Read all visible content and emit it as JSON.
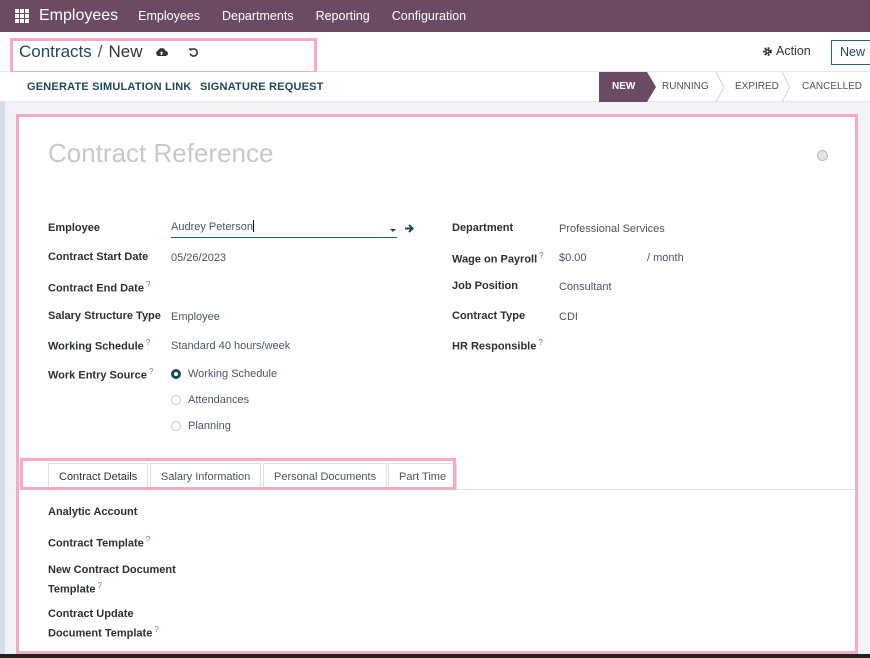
{
  "topbar": {
    "app_name": "Employees",
    "menu": [
      "Employees",
      "Departments",
      "Reporting",
      "Configuration"
    ]
  },
  "control": {
    "breadcrumb_parent": "Contracts",
    "breadcrumb_sep": "/",
    "breadcrumb_current": "New",
    "action_label": "Action",
    "new_label": "New"
  },
  "statusbar": {
    "buttons": [
      "GENERATE SIMULATION LINK",
      "SIGNATURE REQUEST"
    ],
    "stages": [
      "NEW",
      "RUNNING",
      "EXPIRED",
      "CANCELLED"
    ],
    "active_stage": "NEW"
  },
  "form": {
    "title_placeholder": "Contract Reference",
    "left": {
      "employee_label": "Employee",
      "employee_value": "Audrey Peterson",
      "start_label": "Contract Start Date",
      "start_value": "05/26/2023",
      "end_label": "Contract End Date",
      "salary_label": "Salary Structure Type",
      "salary_value": "Employee",
      "schedule_label": "Working Schedule",
      "schedule_value": "Standard 40 hours/week",
      "source_label": "Work Entry Source",
      "source_options": [
        "Working Schedule",
        "Attendances",
        "Planning"
      ],
      "source_selected": "Working Schedule"
    },
    "right": {
      "department_label": "Department",
      "department_value": "Professional Services",
      "wage_label": "Wage on Payroll",
      "wage_value": "$0.00",
      "wage_period": "/ month",
      "job_label": "Job Position",
      "job_value": "Consultant",
      "type_label": "Contract Type",
      "type_value": "CDI",
      "hr_label": "HR Responsible"
    },
    "help_mark": "?"
  },
  "tabs": {
    "items": [
      "Contract Details",
      "Salary Information",
      "Personal Documents",
      "Part Time"
    ],
    "active": "Contract Details"
  },
  "details": {
    "analytic_label": "Analytic Account",
    "template_label": "Contract Template",
    "new_doc_label_1": "New Contract Document",
    "new_doc_label_2": "Template",
    "update_doc_label_1": "Contract Update",
    "update_doc_label_2": "Document Template"
  },
  "colors": {
    "brand": "#6b4a63",
    "accent": "#1f4a55",
    "highlight": "#f8a9c8"
  }
}
